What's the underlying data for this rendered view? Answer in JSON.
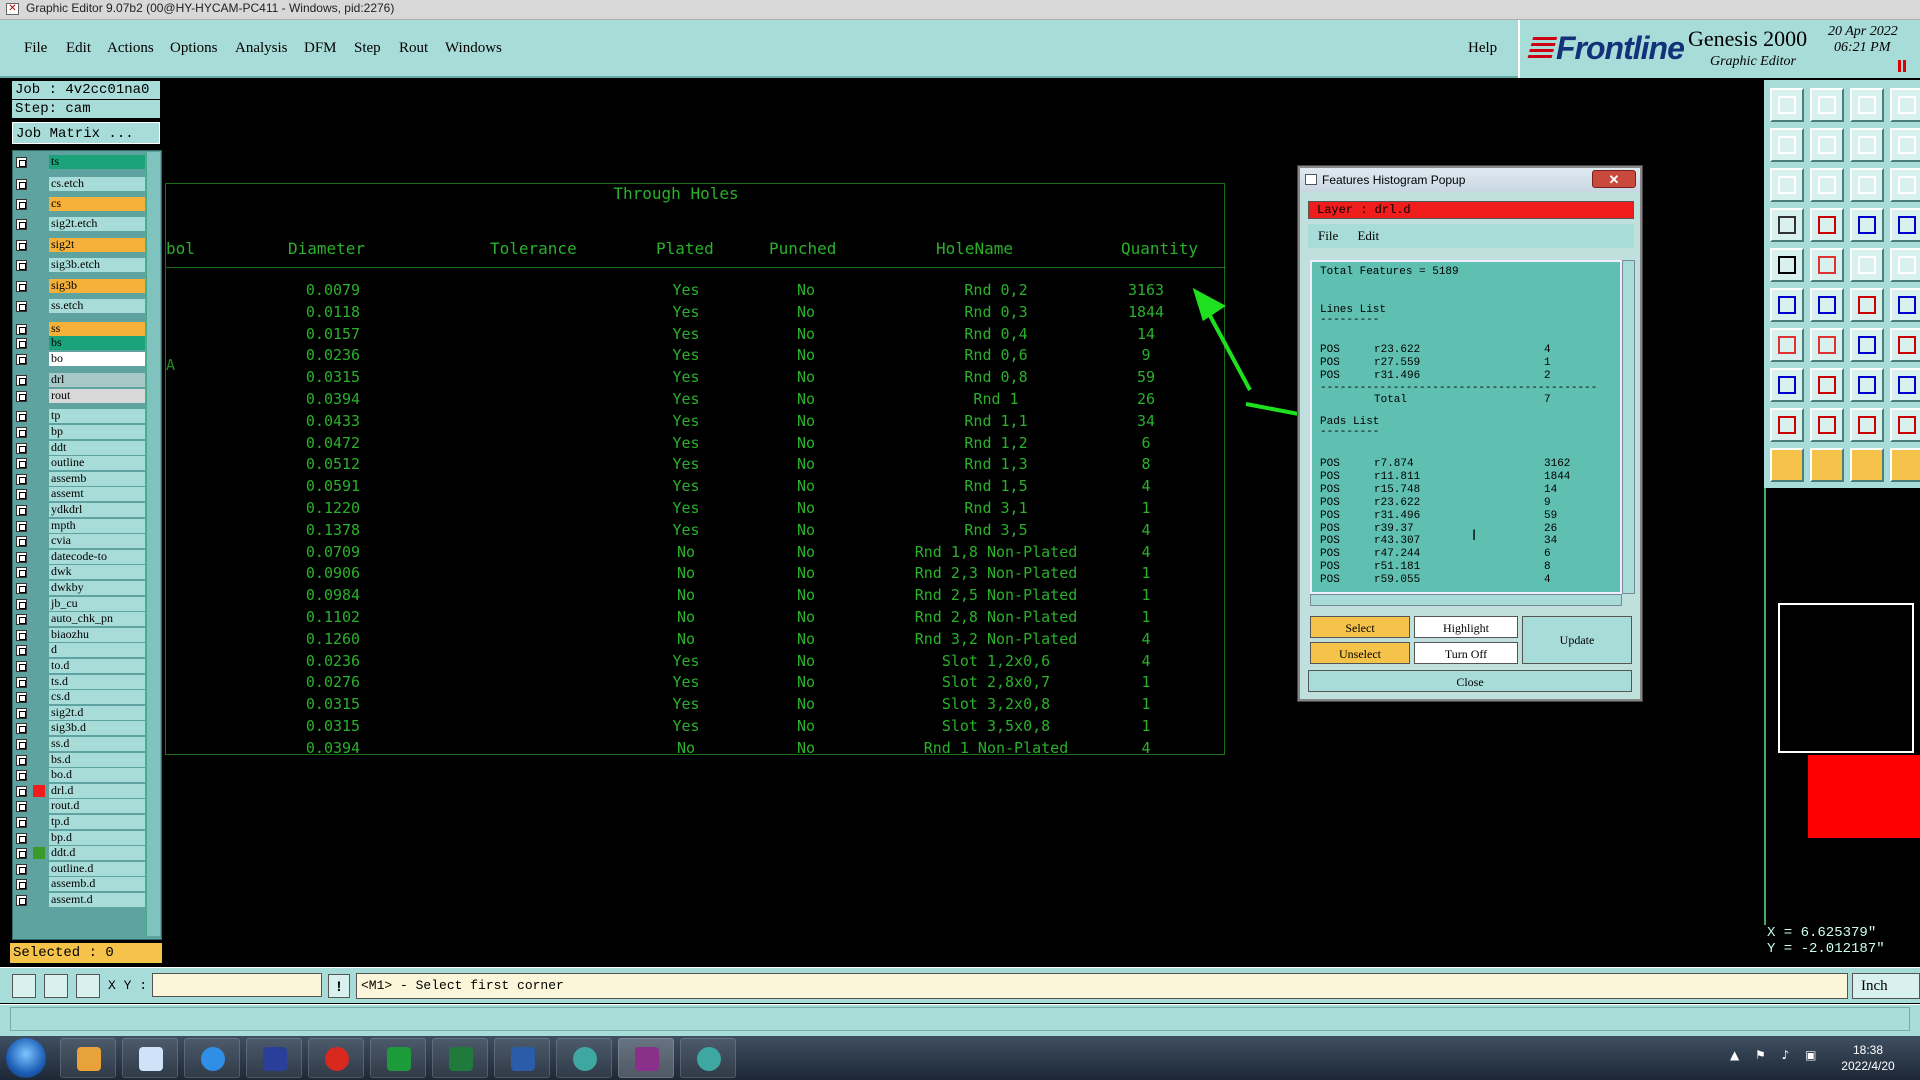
{
  "window": {
    "title": "Graphic Editor 9.07b2 (00@HY-HYCAM-PC411 - Windows, pid:2276)"
  },
  "menu": {
    "items": [
      "File",
      "Edit",
      "Actions",
      "Options",
      "Analysis",
      "DFM",
      "Step",
      "Rout",
      "Windows"
    ],
    "help": "Help"
  },
  "brand": {
    "logo": "Frontline",
    "product": "Genesis 2000",
    "subtitle": "Graphic Editor",
    "date": "20 Apr 2022",
    "time": "06:21 PM"
  },
  "job": {
    "job": "Job : 4v2cc01na0",
    "step": "Step: cam",
    "matrix_button": "Job Matrix ...",
    "selected": "Selected : 0"
  },
  "layers": [
    {
      "name": "ts",
      "color": "#1aa37a"
    },
    {
      "name": "cs.etch",
      "color": "#a8dcd8"
    },
    {
      "name": "cs",
      "color": "#f6b13a"
    },
    {
      "name": "sig2t.etch",
      "color": "#a8dcd8"
    },
    {
      "name": "sig2t",
      "color": "#f6b13a"
    },
    {
      "name": "sig3b.etch",
      "color": "#a8dcd8"
    },
    {
      "name": "sig3b",
      "color": "#f6b13a"
    },
    {
      "name": "ss.etch",
      "color": "#a8dcd8"
    },
    {
      "name": "ss",
      "color": "#f6b13a"
    },
    {
      "name": "bs",
      "color": "#1aa37a"
    },
    {
      "name": "bo",
      "color": "#ffffff"
    },
    {
      "name": "drl",
      "color": "#a8c8c8"
    },
    {
      "name": "rout",
      "color": "#d8d8d8"
    },
    {
      "name": "tp",
      "color": "#a8dcd8"
    },
    {
      "name": "bp",
      "color": "#a8dcd8"
    },
    {
      "name": "ddt",
      "color": "#a8dcd8"
    },
    {
      "name": "outline",
      "color": "#a8dcd8"
    },
    {
      "name": "assemb",
      "color": "#a8dcd8"
    },
    {
      "name": "assemt",
      "color": "#a8dcd8"
    },
    {
      "name": "ydkdrl",
      "color": "#a8dcd8"
    },
    {
      "name": "mpth",
      "color": "#a8dcd8"
    },
    {
      "name": "cvia",
      "color": "#a8dcd8"
    },
    {
      "name": "datecode-to",
      "color": "#a8dcd8"
    },
    {
      "name": "dwk",
      "color": "#a8dcd8"
    },
    {
      "name": "dwkby",
      "color": "#a8dcd8"
    },
    {
      "name": "jb_cu",
      "color": "#a8dcd8"
    },
    {
      "name": "auto_chk_pn",
      "color": "#a8dcd8"
    },
    {
      "name": "biaozhu",
      "color": "#a8dcd8"
    },
    {
      "name": "d",
      "color": "#a8dcd8"
    },
    {
      "name": "to.d",
      "color": "#a8dcd8"
    },
    {
      "name": "ts.d",
      "color": "#a8dcd8"
    },
    {
      "name": "cs.d",
      "color": "#a8dcd8"
    },
    {
      "name": "sig2t.d",
      "color": "#a8dcd8"
    },
    {
      "name": "sig3b.d",
      "color": "#a8dcd8"
    },
    {
      "name": "ss.d",
      "color": "#a8dcd8"
    },
    {
      "name": "bs.d",
      "color": "#a8dcd8"
    },
    {
      "name": "bo.d",
      "color": "#a8dcd8"
    },
    {
      "name": "drl.d",
      "color": "#a8dcd8",
      "mark": "#f01d1d"
    },
    {
      "name": "rout.d",
      "color": "#a8dcd8"
    },
    {
      "name": "tp.d",
      "color": "#a8dcd8"
    },
    {
      "name": "bp.d",
      "color": "#a8dcd8"
    },
    {
      "name": "ddt.d",
      "color": "#a8dcd8",
      "mark": "#3a9a2a"
    },
    {
      "name": "outline.d",
      "color": "#a8dcd8"
    },
    {
      "name": "assemb.d",
      "color": "#a8dcd8"
    },
    {
      "name": "assemt.d",
      "color": "#a8dcd8"
    }
  ],
  "holes": {
    "title": "Through Holes",
    "headers": [
      "bol",
      "Diameter",
      "Tolerance",
      "Plated",
      "Punched",
      "HoleName",
      "Quantity"
    ],
    "side_mark": "A",
    "rows": [
      [
        "0.0079",
        "Yes",
        "No",
        "Rnd 0,2",
        "3163"
      ],
      [
        "0.0118",
        "Yes",
        "No",
        "Rnd 0,3",
        "1844"
      ],
      [
        "0.0157",
        "Yes",
        "No",
        "Rnd 0,4",
        "14"
      ],
      [
        "0.0236",
        "Yes",
        "No",
        "Rnd 0,6",
        "9"
      ],
      [
        "0.0315",
        "Yes",
        "No",
        "Rnd 0,8",
        "59"
      ],
      [
        "0.0394",
        "Yes",
        "No",
        "Rnd 1",
        "26"
      ],
      [
        "0.0433",
        "Yes",
        "No",
        "Rnd 1,1",
        "34"
      ],
      [
        "0.0472",
        "Yes",
        "No",
        "Rnd 1,2",
        "6"
      ],
      [
        "0.0512",
        "Yes",
        "No",
        "Rnd 1,3",
        "8"
      ],
      [
        "0.0591",
        "Yes",
        "No",
        "Rnd 1,5",
        "4"
      ],
      [
        "0.1220",
        "Yes",
        "No",
        "Rnd 3,1",
        "1"
      ],
      [
        "0.1378",
        "Yes",
        "No",
        "Rnd 3,5",
        "4"
      ],
      [
        "0.0709",
        "No",
        "No",
        "Rnd 1,8 Non-Plated",
        "4"
      ],
      [
        "0.0906",
        "No",
        "No",
        "Rnd 2,3 Non-Plated",
        "1"
      ],
      [
        "0.0984",
        "No",
        "No",
        "Rnd 2,5 Non-Plated",
        "1"
      ],
      [
        "0.1102",
        "No",
        "No",
        "Rnd 2,8 Non-Plated",
        "1"
      ],
      [
        "0.1260",
        "No",
        "No",
        "Rnd 3,2 Non-Plated",
        "4"
      ],
      [
        "0.0236",
        "Yes",
        "No",
        "Slot 1,2x0,6",
        "4"
      ],
      [
        "0.0276",
        "Yes",
        "No",
        "Slot 2,8x0,7",
        "1"
      ],
      [
        "0.0315",
        "Yes",
        "No",
        "Slot 3,2x0,8",
        "1"
      ],
      [
        "0.0315",
        "Yes",
        "No",
        "Slot 3,5x0,8",
        "1"
      ],
      [
        "0.0394",
        "No",
        "No",
        "Rnd 1 Non-Plated",
        "4"
      ]
    ]
  },
  "popup": {
    "title": "Features Histogram Popup",
    "close_x": "✕",
    "layer": "Layer :  drl.d",
    "menu": [
      "File",
      "Edit"
    ],
    "total": "Total Features = 5189",
    "lines_header": "Lines List",
    "dashes_short": "---------",
    "lines": [
      [
        "POS",
        "r23.622",
        "4"
      ],
      [
        "POS",
        "r27.559",
        "1"
      ],
      [
        "POS",
        "r31.496",
        "2"
      ]
    ],
    "dashes_long": "------------------------------------------",
    "total_label": "Total",
    "total_value": "7",
    "pads_header": "Pads List",
    "pads": [
      [
        "POS",
        "r7.874",
        "3162"
      ],
      [
        "POS",
        "r11.811",
        "1844"
      ],
      [
        "POS",
        "r15.748",
        "14"
      ],
      [
        "POS",
        "r23.622",
        "9"
      ],
      [
        "POS",
        "r31.496",
        "59"
      ],
      [
        "POS",
        "r39.37",
        "26"
      ],
      [
        "POS",
        "r43.307",
        "34"
      ],
      [
        "POS",
        "r47.244",
        "6"
      ],
      [
        "POS",
        "r51.181",
        "8"
      ],
      [
        "POS",
        "r59.055",
        "4"
      ]
    ],
    "buttons": {
      "select": "Select",
      "highlight": "Highlight",
      "update": "Update",
      "unselect": "Unselect",
      "turn_off": "Turn Off",
      "close": "Close"
    }
  },
  "colors": {
    "panel": "#a8dcd8",
    "table_text": "#2bb02b",
    "highlight": "#f6c34a",
    "arrow": "#1fe01f",
    "layer_field": "#f01d1d"
  },
  "coords": {
    "x": "X =  6.625379\"",
    "y": "Y = -2.012187\""
  },
  "command": {
    "xy_label": "X Y :",
    "status": "<M1> - Select first corner",
    "units": "Inch",
    "bang": "!"
  },
  "taskbar": {
    "time": "18:38",
    "date": "2022/4/20"
  }
}
